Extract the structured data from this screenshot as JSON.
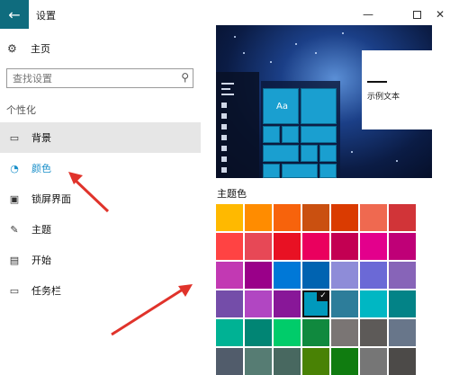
{
  "window": {
    "title": "设置",
    "back_icon": "back-arrow-icon",
    "minimize": "—",
    "close": "✕"
  },
  "nav": {
    "home": "主页",
    "search_placeholder": "查找设置",
    "section": "个性化",
    "items": [
      {
        "label": "背景",
        "icon": "image-icon"
      },
      {
        "label": "颜色",
        "icon": "palette-icon"
      },
      {
        "label": "锁屏界面",
        "icon": "lock-screen-icon"
      },
      {
        "label": "主题",
        "icon": "theme-icon"
      },
      {
        "label": "开始",
        "icon": "start-menu-icon"
      },
      {
        "label": "任务栏",
        "icon": "taskbar-icon"
      }
    ]
  },
  "preview": {
    "tile_label": "Aa",
    "sample_text": "示例文本"
  },
  "accent": {
    "header": "主题色",
    "colors": [
      [
        "#ffb900",
        "#ff8c00",
        "#f7630c",
        "#ca5010",
        "#da3b01",
        "#ef6950",
        "#d13438"
      ],
      [
        "#ff4343",
        "#e74856",
        "#e81123",
        "#ea005e",
        "#c30052",
        "#e3008c",
        "#bf0077"
      ],
      [
        "#c239b3",
        "#9a0089",
        "#0078d7",
        "#0063b1",
        "#8e8cd8",
        "#6b69d6",
        "#8764b8"
      ],
      [
        "#744da9",
        "#b146c2",
        "#881798",
        "#0099bc",
        "#2d7d9a",
        "#00b7c3",
        "#038387"
      ],
      [
        "#00b294",
        "#018574",
        "#00cc6a",
        "#10893e",
        "#7a7574",
        "#5d5a58",
        "#68768a"
      ],
      [
        "#515c6b",
        "#567c73",
        "#486860",
        "#498205",
        "#107c10",
        "#767676",
        "#4c4a48"
      ]
    ],
    "selected": "#0099bc"
  }
}
